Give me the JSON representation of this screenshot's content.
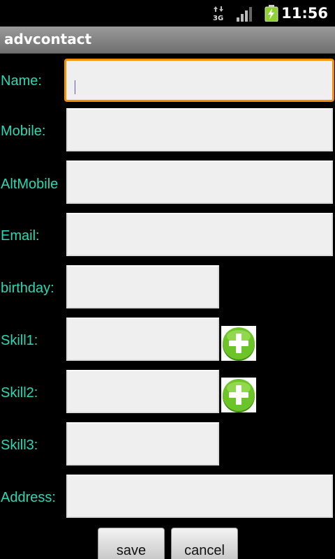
{
  "status_bar": {
    "network_label": "3G",
    "time": "11:56",
    "icons": [
      "data-arrows-icon",
      "signal-icon",
      "battery-charging-icon"
    ]
  },
  "app": {
    "title": "advcontact"
  },
  "form": {
    "name_label": "Name:",
    "mobile_label": "Mobile:",
    "altmobile_label": "AltMobile",
    "email_label": "Email:",
    "birthday_label": "birthday:",
    "skill1_label": "Skill1:",
    "skill2_label": "Skill2:",
    "skill3_label": "Skill3:",
    "address_label": "Address:",
    "name_value": "",
    "mobile_value": "",
    "altmobile_value": "",
    "email_value": "",
    "birthday_value": "",
    "skill1_value": "",
    "skill2_value": "",
    "skill3_value": "",
    "address_value": ""
  },
  "buttons": {
    "save_label": "save",
    "cancel_label": "cancel",
    "add_icon": "plus-circle-icon"
  },
  "colors": {
    "label": "#2ad9b4",
    "focus_border": "#f29000",
    "add_green": "#5fbf1e"
  }
}
